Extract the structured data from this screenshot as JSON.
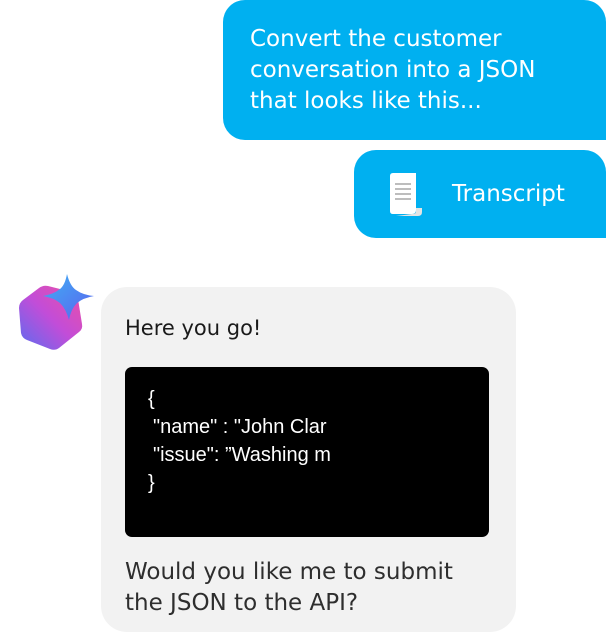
{
  "conversation": {
    "user_message": "Convert the customer conversation into a JSON that looks like this...",
    "attachment": {
      "icon": "document-icon",
      "label": "Transcript"
    },
    "assistant": {
      "avatar_icon": "sparkle-hexagon-icon",
      "greeting": "Here you go!",
      "code_lines": [
        "{",
        " \"name\" : \"John Clar",
        " \"issue\": ”Washing m",
        "}"
      ],
      "question": "Would you like me to submit the JSON to the API?"
    }
  },
  "colors": {
    "user_bubble": "#00b0f0",
    "assistant_bubble": "#f2f2f2",
    "code_background": "#000000",
    "avatar_gradient": [
      "#5a6df0",
      "#c24dd8",
      "#ee4fa4"
    ]
  }
}
